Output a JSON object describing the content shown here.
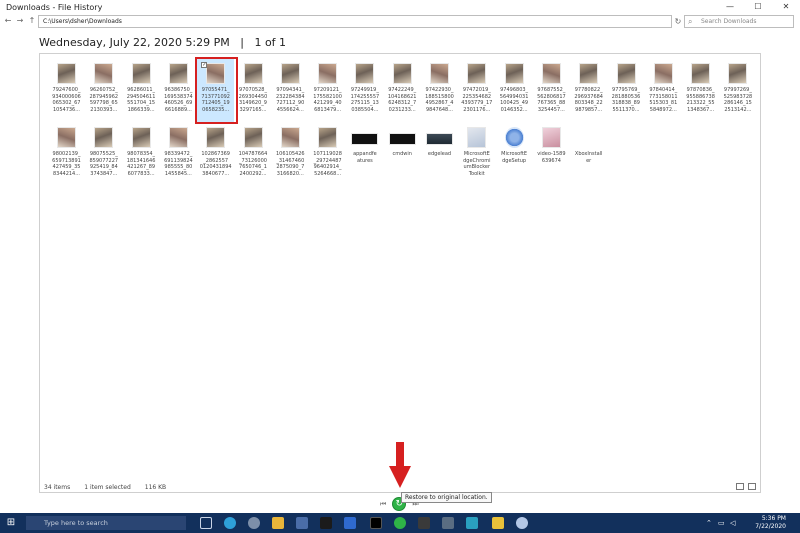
{
  "window": {
    "title": "Downloads - File History",
    "min": "—",
    "max": "☐",
    "close": "✕"
  },
  "address": {
    "back": "←",
    "forward": "→",
    "up": "↑",
    "path": "C:\\Users\\dsher\\Downloads",
    "refresh": "↻",
    "search_placeholder": "Search Downloads"
  },
  "heading": "Wednesday, July 22, 2020 5:29 PM   |   1 of 1",
  "files": [
    {
      "label": "79247600_\n934000606\n065302_67\n1054736...",
      "kind": "photo"
    },
    {
      "label": "96260752_\n287945962\n597798_65\n2130393...",
      "kind": "photo"
    },
    {
      "label": "96286011_\n294504611\n551704_15\n1866339...",
      "kind": "photo"
    },
    {
      "label": "96386750_\n169538374\n460526_69\n6616889...",
      "kind": "photo"
    },
    {
      "label": "97055471_\n713771092\n712405_19\n0658235...",
      "kind": "photo",
      "selected": true
    },
    {
      "label": "97070528_\n269304450\n3149620_9\n3297165...",
      "kind": "photo"
    },
    {
      "label": "97094341_\n232284384\n727112_90\n4556624...",
      "kind": "photo"
    },
    {
      "label": "97209121_\n175582100\n421299_40\n6813479...",
      "kind": "photo"
    },
    {
      "label": "97249919_\n174255557\n275115_13\n0385504...",
      "kind": "photo"
    },
    {
      "label": "97422249_\n104168621\n6248312_7\n0231233...",
      "kind": "photo"
    },
    {
      "label": "97422930_\n188515800\n4952867_4\n9847648...",
      "kind": "photo"
    },
    {
      "label": "97472019_\n225354682\n4393779_17\n2301176...",
      "kind": "photo"
    },
    {
      "label": "97496803_\n564994031\n100425_49\n0146352...",
      "kind": "photo"
    },
    {
      "label": "97687552_\n562806817\n767365_88\n3254457...",
      "kind": "photo"
    },
    {
      "label": "97780822_\n296937684\n803348_22\n9879857...",
      "kind": "photo"
    },
    {
      "label": "97795769_\n281880536\n318838_89\n5511370...",
      "kind": "photo"
    },
    {
      "label": "97840414_\n773158011\n515303_81\n5848972...",
      "kind": "photo"
    },
    {
      "label": "97870836_\n955886738\n213322_55\n1348367...",
      "kind": "photo"
    },
    {
      "label": "97997269_\n525983728\n286146_15\n2513142...",
      "kind": "photo"
    },
    {
      "label": "98002139_\n659713891\n427459_35\n8344214...",
      "kind": "photo"
    },
    {
      "label": "98075525_\n859077227\n925419_84\n3743847...",
      "kind": "photo"
    },
    {
      "label": "98078354_\n181341646\n421267_89\n6077833...",
      "kind": "photo"
    },
    {
      "label": "98339472_\n691139824\n985555_80\n1455845...",
      "kind": "photo"
    },
    {
      "label": "102867369\n_2862557\n0120431894\n3840677...",
      "kind": "photo"
    },
    {
      "label": "104787664\n_73126000\n7650746_1\n2400292...",
      "kind": "photo"
    },
    {
      "label": "106105426\n_31467460\n2875090_7\n3166820...",
      "kind": "photo"
    },
    {
      "label": "107119028\n_29724487\n96402914_\n5264668...",
      "kind": "photo"
    },
    {
      "label": "appandfe\natures",
      "kind": "black"
    },
    {
      "label": "cmdwin",
      "kind": "black"
    },
    {
      "label": "edgelead",
      "kind": "teal"
    },
    {
      "label": "MicrosoftE\ndgeChromi\numBlocker\nToolkit",
      "kind": "doc"
    },
    {
      "label": "MicrosoftE\ndgeSetup",
      "kind": "disc"
    },
    {
      "label": "video-1589\n639674",
      "kind": "pink"
    },
    {
      "label": "XboxInstall\ner",
      "kind": "none"
    }
  ],
  "status": {
    "items": "34 items",
    "selected": "1 item selected",
    "size": "116 KB"
  },
  "controls": {
    "prev": "⏮",
    "restore": "↻",
    "next": "⏭",
    "tooltip": "Restore to original location."
  },
  "taskbar": {
    "start": "⊞",
    "search_placeholder": "Type here to search",
    "time": "5:36 PM",
    "date": "7/22/2020"
  },
  "colors": {
    "accent_arrow": "#d62020",
    "restore_green": "#2fb347",
    "taskbar": "#12305c",
    "selection": "#cce8ff"
  }
}
